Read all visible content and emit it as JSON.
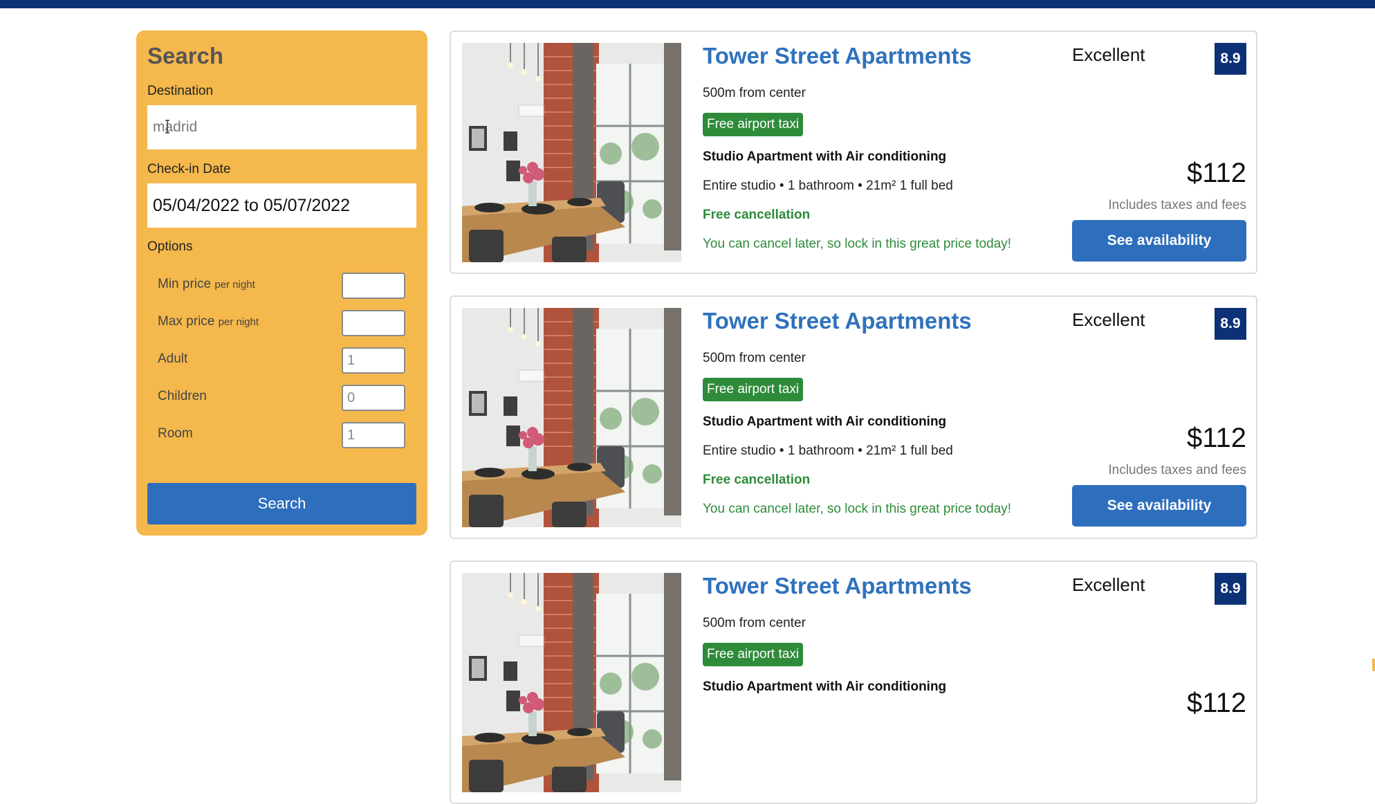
{
  "colors": {
    "top_bar": "#0d3177",
    "search_panel": "#f4b84c",
    "primary_button": "#2e6fbd",
    "hotel_link": "#2f72bd",
    "green": "#2e8b3a",
    "rating_badge": "#0d3177"
  },
  "search": {
    "title": "Search",
    "destination_label": "Destination",
    "destination_value": "madrid",
    "checkin_label": "Check-in Date",
    "date_range": "05/04/2022 to 05/07/2022",
    "options_label": "Options",
    "options": {
      "min_price": {
        "label": "Min price",
        "suffix": "per night",
        "value": ""
      },
      "max_price": {
        "label": "Max price",
        "suffix": "per night",
        "value": ""
      },
      "adult": {
        "label": "Adult",
        "value": "1"
      },
      "children": {
        "label": "Children",
        "value": "0"
      },
      "room": {
        "label": "Room",
        "value": "1"
      }
    },
    "button_label": "Search"
  },
  "results": [
    {
      "name": "Tower Street Apartments",
      "distance": "500m from center",
      "taxi": "Free airport taxi",
      "room_type": "Studio Apartment with Air conditioning",
      "room_details": "Entire studio • 1 bathroom • 21m² 1 full bed",
      "cancellation": "Free cancellation",
      "cancellation_note": "You can cancel later, so lock in this great price today!",
      "rating_text": "Excellent",
      "rating": "8.9",
      "price": "$112",
      "tax_note": "Includes taxes and fees",
      "button_label": "See availability"
    },
    {
      "name": "Tower Street Apartments",
      "distance": "500m from center",
      "taxi": "Free airport taxi",
      "room_type": "Studio Apartment with Air conditioning",
      "room_details": "Entire studio • 1 bathroom • 21m² 1 full bed",
      "cancellation": "Free cancellation",
      "cancellation_note": "You can cancel later, so lock in this great price today!",
      "rating_text": "Excellent",
      "rating": "8.9",
      "price": "$112",
      "tax_note": "Includes taxes and fees",
      "button_label": "See availability"
    },
    {
      "name": "Tower Street Apartments",
      "distance": "500m from center",
      "taxi": "Free airport taxi",
      "room_type": "Studio Apartment with Air conditioning",
      "rating_text": "Excellent",
      "rating": "8.9",
      "price": "$112"
    }
  ]
}
